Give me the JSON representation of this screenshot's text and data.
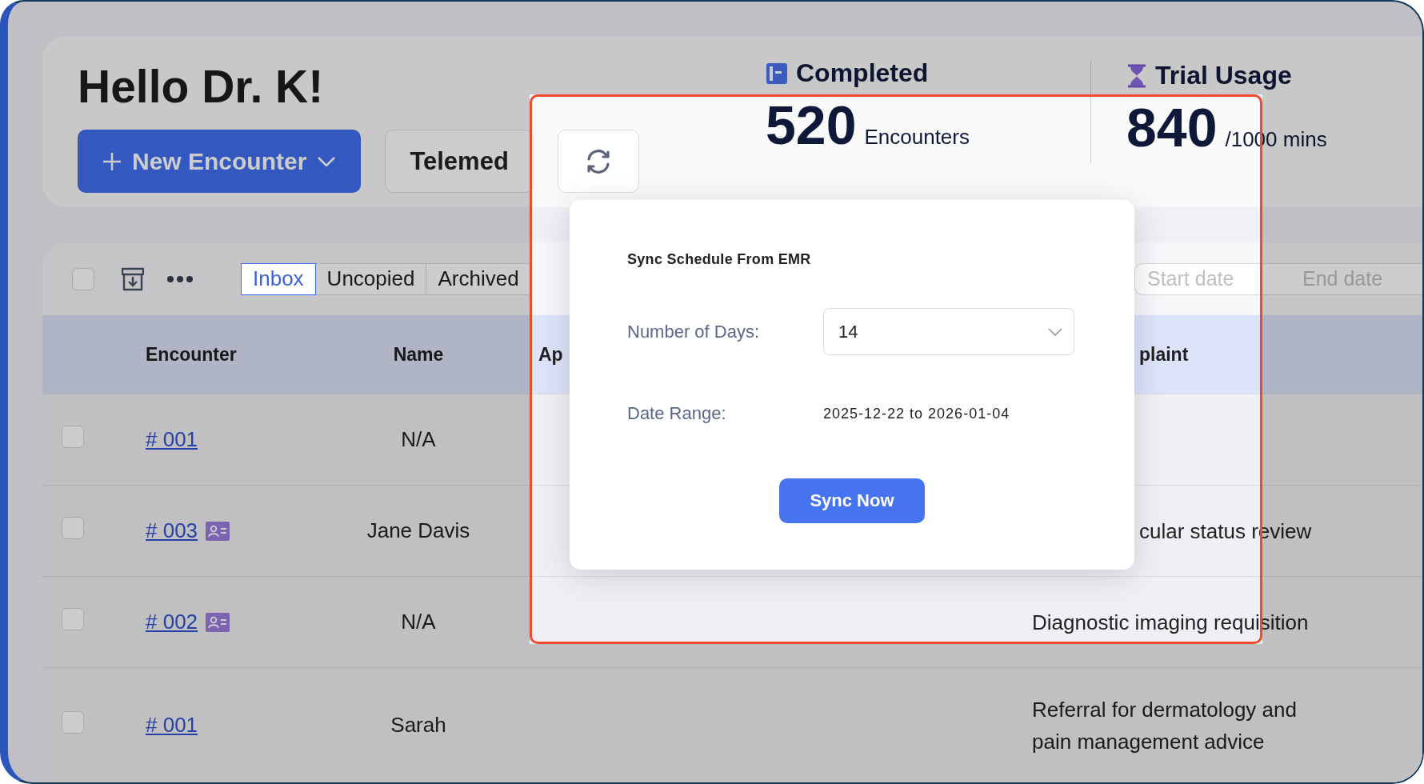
{
  "greeting": "Hello Dr. K!",
  "actions": [
    {
      "kind": "primary",
      "label": "New Encounter"
    },
    {
      "kind": "secondary",
      "label": "Telemed"
    },
    {
      "kind": "sync"
    }
  ],
  "stats": [
    {
      "kind": "completed",
      "title": "Completed",
      "value": "520",
      "unit": "Encounters"
    },
    {
      "kind": "trial",
      "title": "Trial Usage",
      "value": "840",
      "unit": "/1000 mins"
    }
  ],
  "toolbar": {
    "select_all_checked": false,
    "tabs": [
      {
        "label": "Inbox",
        "selected": true
      },
      {
        "label": "Uncopied",
        "selected": false
      },
      {
        "label": "Archived",
        "selected": false
      }
    ],
    "date_range": {
      "start_placeholder": "Start date",
      "end_placeholder": "End date"
    }
  },
  "table": {
    "columns": [
      "Encounter",
      "Name",
      "Ap",
      "plaint"
    ],
    "rows": [
      {
        "checked": false,
        "encounter": "# 001",
        "has_card": false,
        "name": "N/A"
      },
      {
        "checked": false,
        "encounter": "# 003",
        "has_card": true,
        "name": "Jane Davis",
        "complaint": "cular status review"
      },
      {
        "checked": false,
        "encounter": "# 002",
        "has_card": true,
        "name": "N/A",
        "complaint": "Diagnostic imaging requisition"
      },
      {
        "checked": false,
        "encounter": "# 001",
        "has_card": false,
        "name": "Sarah",
        "complaint": "Referral for dermatology and pain management advice"
      }
    ]
  },
  "sync_dialog": {
    "title": "Sync Schedule From EMR",
    "days_label": "Number of Days:",
    "days_value": "14",
    "range_label": "Date Range:",
    "range_value": "2025-12-22 to 2026-01-04",
    "button": "Sync Now"
  }
}
